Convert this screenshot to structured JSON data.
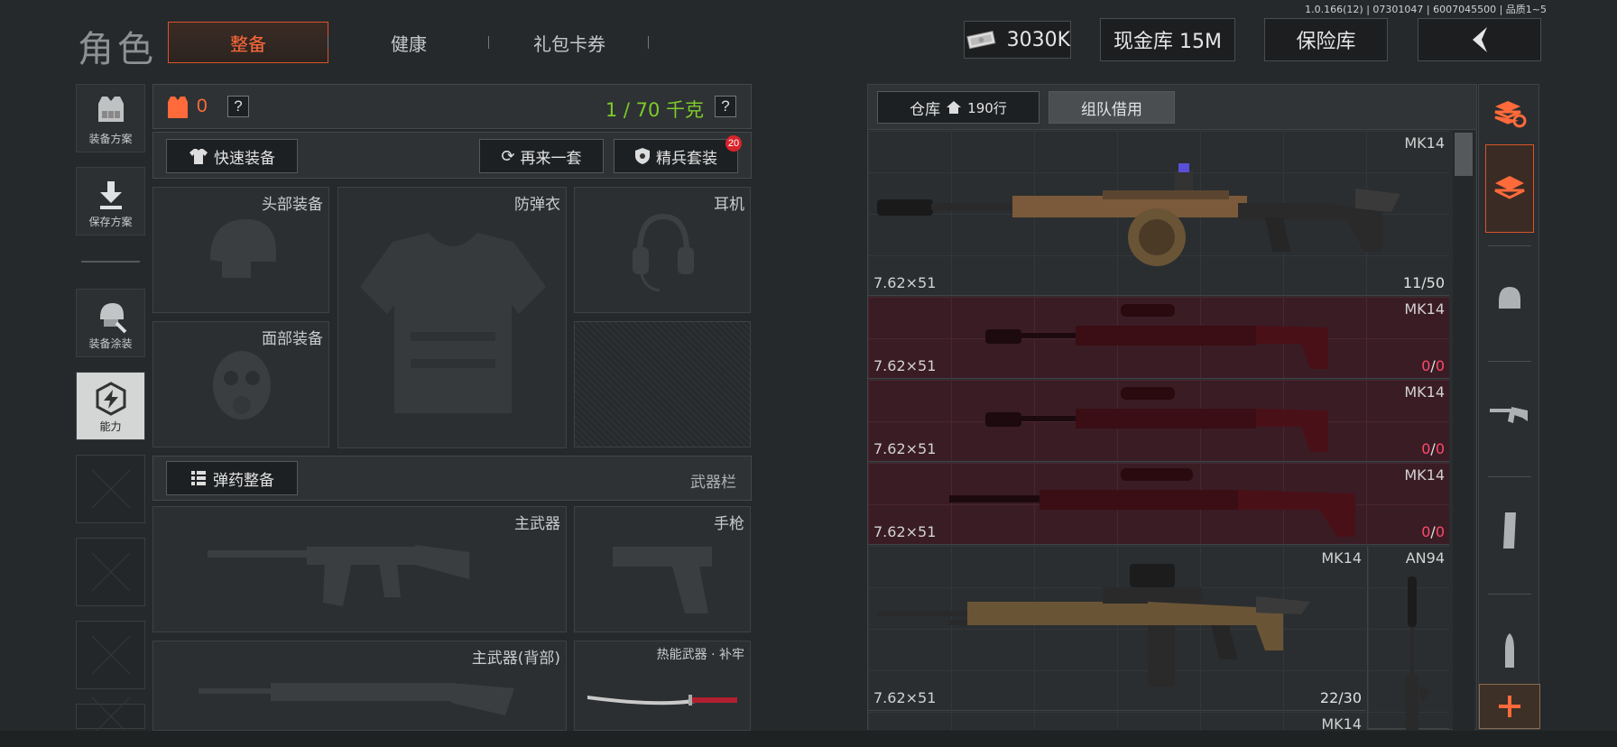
{
  "version": "1.0.166(12) | 07301047 | 6007045500 | 品质1~5",
  "title": "角色",
  "tabs": [
    {
      "label": "整备",
      "active": true
    },
    {
      "label": "健康",
      "active": false
    },
    {
      "label": "礼包卡券",
      "active": false
    }
  ],
  "header": {
    "money": "3030K",
    "cash_vault": "现金库 15M",
    "safe": "保险库"
  },
  "left_rail": {
    "plan": "装备方案",
    "save": "保存方案",
    "skin": "装备涂装",
    "ability": "能力"
  },
  "loadout": {
    "armor_count": "0",
    "help": "?",
    "weight": "1 / 70 千克",
    "quick_equip": "快速装备",
    "again": "再来一套",
    "elite": "精兵套装",
    "elite_badge": "20",
    "slots": {
      "head": "头部装备",
      "vest": "防弹衣",
      "ear": "耳机",
      "face": "面部装备",
      "primary": "主武器",
      "pistol": "手枪",
      "primary_back": "主武器(背部)",
      "melee": "热能武器 · 补牢"
    },
    "ammo_btn": "弹药整备",
    "weapon_bar": "武器栏"
  },
  "warehouse": {
    "tab_label": "仓库",
    "tab_rows": "190行",
    "team_borrow": "组队借用",
    "items": [
      {
        "name": "MK14",
        "caliber": "7.62×51",
        "count": "11/50",
        "red": false
      },
      {
        "name": "MK14",
        "caliber": "7.62×51",
        "count_a": "0",
        "count_b": "0",
        "red": true
      },
      {
        "name": "MK14",
        "caliber": "7.62×51",
        "count_a": "0",
        "count_b": "0",
        "red": true
      },
      {
        "name": "MK14",
        "caliber": "7.62×51",
        "count_a": "0",
        "count_b": "0",
        "red": true
      },
      {
        "name": "MK14",
        "caliber": "7.62×51",
        "count": "22/30",
        "red": false
      },
      {
        "name": "AN94"
      },
      {
        "name": "MK14"
      }
    ]
  },
  "colors": {
    "accent": "#ff6a3a",
    "weight_green": "#7ecb2a",
    "unavailable_red": "#3a1c25"
  }
}
